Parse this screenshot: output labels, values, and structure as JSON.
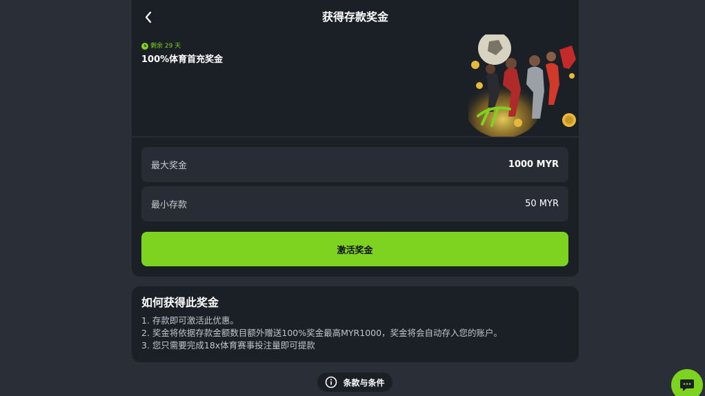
{
  "header": {
    "title": "获得存款奖金"
  },
  "promo": {
    "remaining": "剩余 29 天",
    "title": "100%体育首充奖金",
    "art_icon": "sports-players-illustration"
  },
  "details": {
    "max_bonus_label": "最大奖金",
    "max_bonus_value": "1000 MYR",
    "min_deposit_label": "最小存款",
    "min_deposit_value": "50 MYR"
  },
  "actions": {
    "activate_label": "激活奖金"
  },
  "howto": {
    "title": "如何获得此奖金",
    "steps": [
      "1. 存款即可激活此优惠。",
      "2. 奖金将依据存款金额数目额外赠送100%奖金最高MYR1000，奖金将会自动存入您的账户。",
      "3. 您只需要完成18x体育赛事投注量即可提款"
    ]
  },
  "terms": {
    "label": "条款与条件"
  },
  "colors": {
    "accent": "#7ed321",
    "card": "#1b1f26",
    "background": "#2a2f37",
    "row": "#282d35"
  }
}
